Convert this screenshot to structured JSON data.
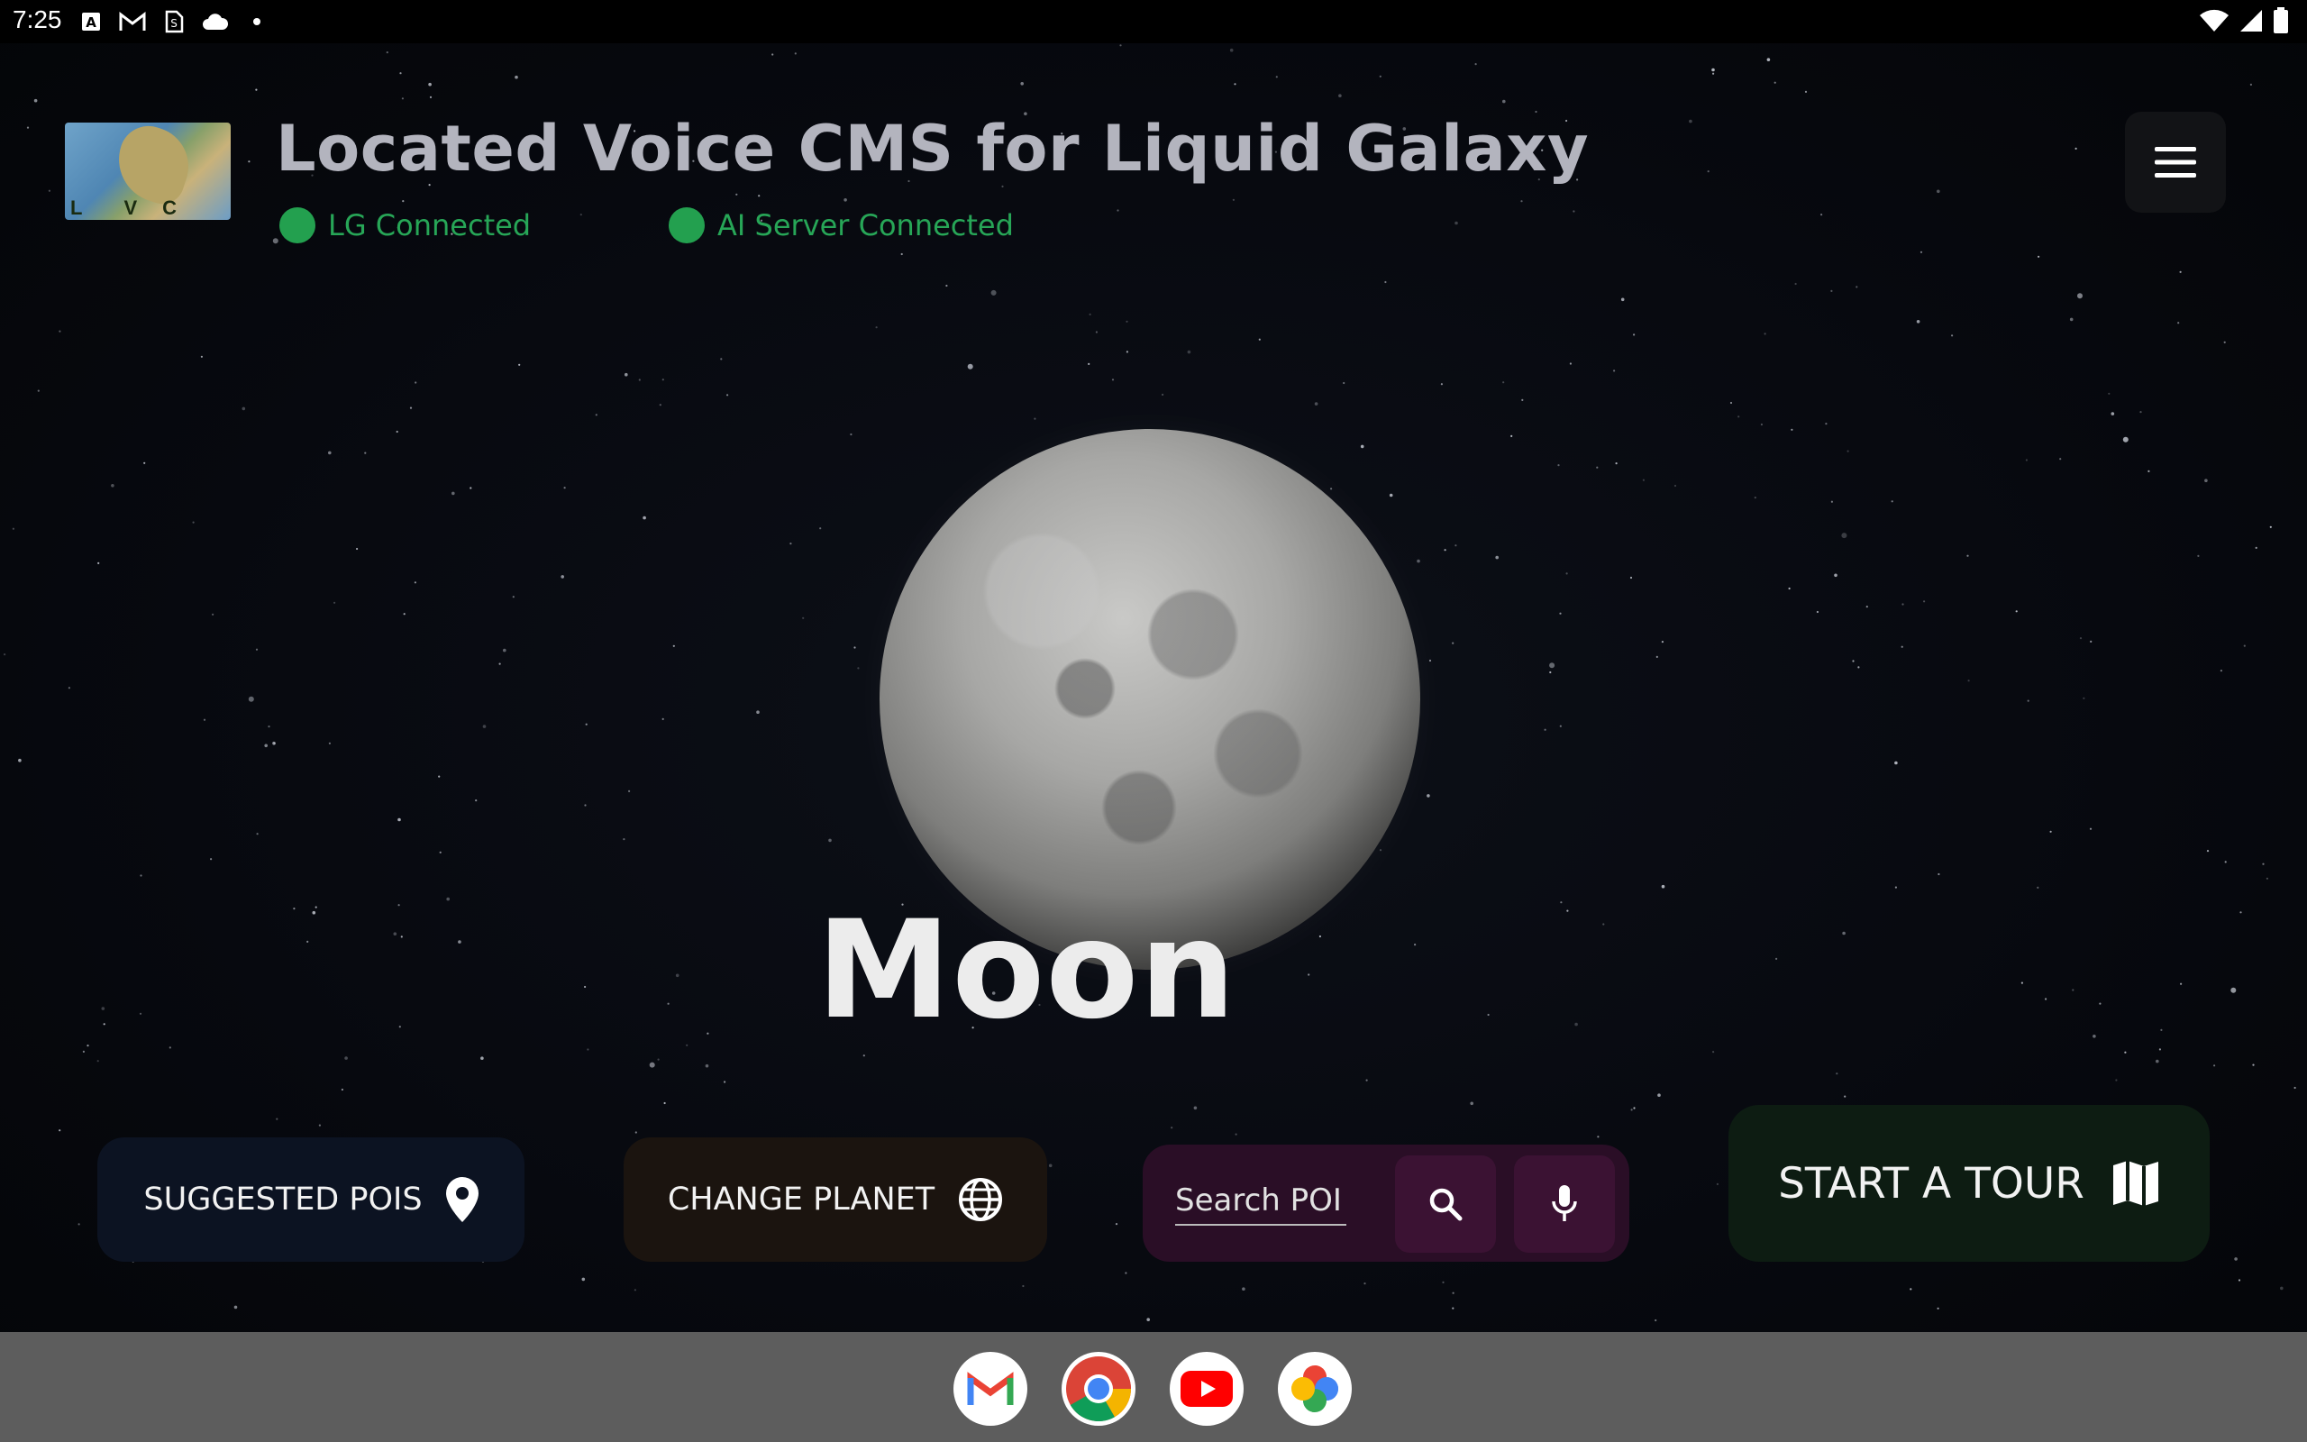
{
  "status_bar": {
    "time": "7:25",
    "left_icons": [
      "a-box-icon",
      "gmail-icon",
      "sim-icon",
      "cloud-icon",
      "dot-icon"
    ],
    "right_icons": [
      "wifi-icon",
      "signal-icon",
      "battery-icon"
    ]
  },
  "header": {
    "title": "Located Voice CMS for Liquid Galaxy",
    "logo_letters": [
      "L",
      "V",
      "C"
    ],
    "status": [
      {
        "label": "LG Connected",
        "color": "#23a04f"
      },
      {
        "label": "AI Server Connected",
        "color": "#23a04f"
      }
    ],
    "menu_icon": "hamburger-menu-icon"
  },
  "planet": {
    "name": "Moon"
  },
  "actions": {
    "suggested_pois_label": "SUGGESTED POIS",
    "suggested_pois_icon": "location-pin-icon",
    "change_planet_label": "CHANGE PLANET",
    "change_planet_icon": "globe-icon",
    "search_placeholder": "Search POI",
    "search_icon": "search-icon",
    "mic_icon": "microphone-icon",
    "tour_label": "START A TOUR",
    "tour_icon": "map-icon"
  },
  "dock": {
    "apps": [
      "Gmail",
      "Chrome",
      "YouTube",
      "Photos"
    ]
  },
  "colors": {
    "accent_green": "#23a04f",
    "title_gray": "#b3b4be",
    "pois_bg": "#0c1322",
    "planet_bg": "#1b140f",
    "search_bg": "#2a0e26",
    "tour_bg": "#0d1c12"
  }
}
